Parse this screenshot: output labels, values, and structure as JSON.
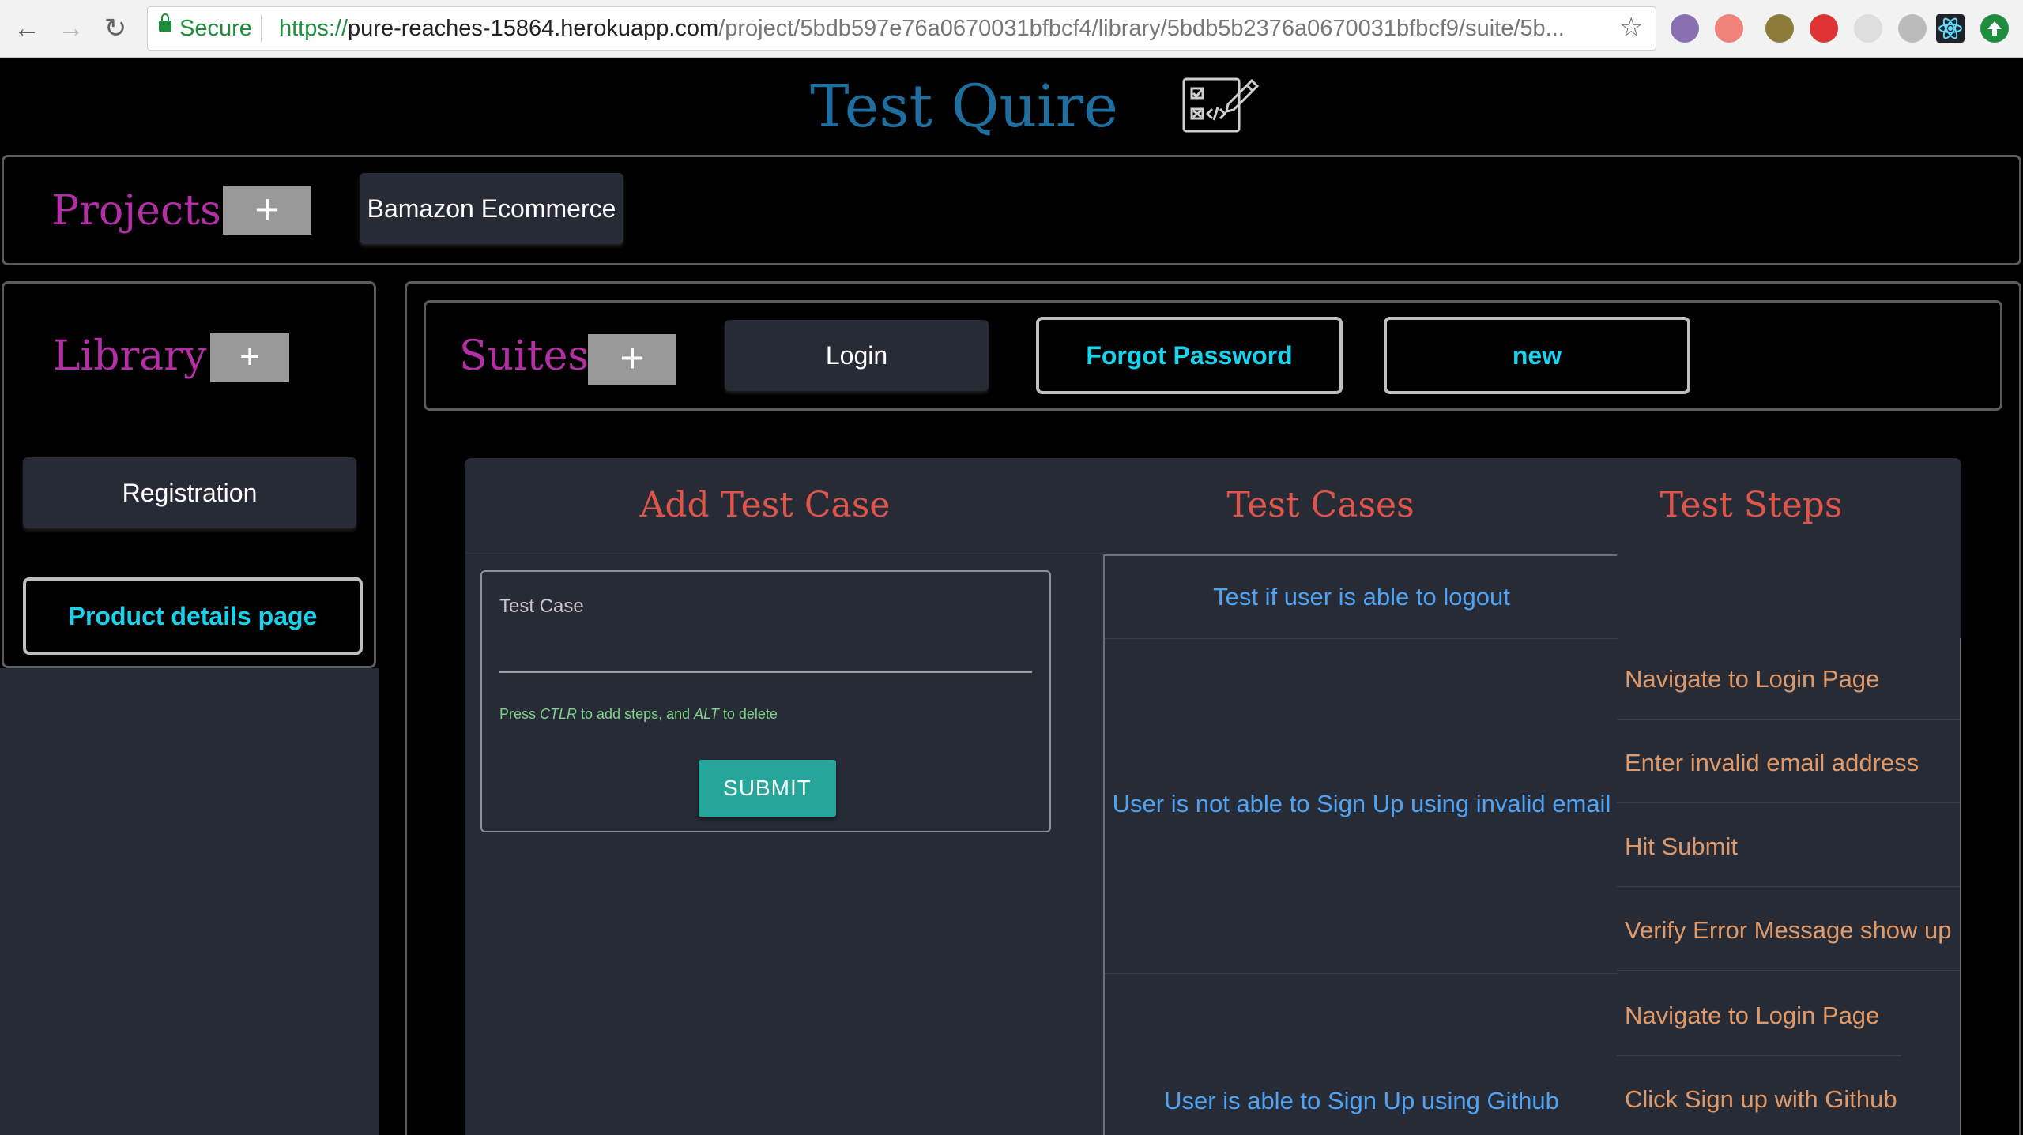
{
  "browser": {
    "secure_label": "Secure",
    "url_scheme": "https://",
    "url_host": "pure-reaches-15864.herokuapp.com",
    "url_path": "/project/5bdb597e76a0670031bfbcf4/library/5bdb5b2376a0670031bfbcf9/suite/5b...",
    "back_icon": "←",
    "forward_icon": "→",
    "reload_icon": "↻",
    "star_icon": "☆"
  },
  "app": {
    "title": "Test Quire",
    "title_color": "#1e6fa0"
  },
  "projects": {
    "label": "Projects",
    "add_label": "+",
    "items": [
      "Bamazon Ecommerce"
    ]
  },
  "library": {
    "label": "Library",
    "add_label": "+",
    "items": [
      "Registration",
      "Product details page"
    ]
  },
  "suites": {
    "label": "Suites",
    "add_label": "+",
    "items": [
      "Login",
      "Forgot Password",
      "new"
    ]
  },
  "add_test_case": {
    "heading": "Add Test Case",
    "field_label": "Test Case",
    "field_value": "",
    "hint_prefix": "Press ",
    "hint_key1": "CTLR",
    "hint_middle": " to add steps, and ",
    "hint_key2": "ALT",
    "hint_suffix": " to delete",
    "submit_label": "SUBMIT"
  },
  "test_cases": {
    "heading": "Test Cases",
    "items": [
      "Test if user is able to logout",
      "User is not able to Sign Up using invalid email",
      "User is able to Sign Up using Github"
    ]
  },
  "test_steps": {
    "heading": "Test Steps",
    "items": [
      "Navigate to Login Page",
      "Enter invalid email address",
      "Hit Submit",
      "Verify Error Message show up",
      "Navigate to Login Page",
      "Click Sign up with Github"
    ]
  },
  "colors": {
    "accent_magenta": "#b42fa6",
    "heading_red": "#e0544a",
    "case_blue": "#4fa3f5",
    "step_orange": "#e09a6a",
    "outline_cyan": "#18d3ee",
    "submit_teal": "#26a69a"
  }
}
